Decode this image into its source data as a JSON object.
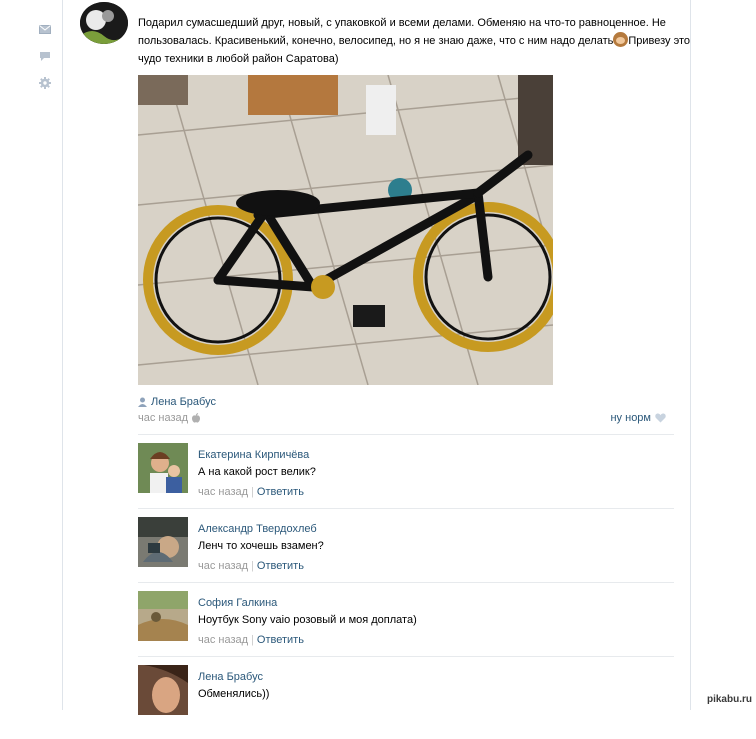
{
  "sidebar": {
    "icons": [
      "envelope-icon",
      "speech-bubble-icon",
      "gear-icon"
    ]
  },
  "post": {
    "text_part1": "Подарил сумасшедший друг, новый, с упаковкой и всеми делами. Обменяю на что-то равноценное. Не пользовалась. Красивенький, конечно, велосипед, но я не знаю даже, что с ним надо делать",
    "text_part2": "Привезу это чудо техники в любой район Саратова)",
    "emoji": "see-no-evil-monkey",
    "photo_subject": "black BMX bike with gold wheels",
    "author": "Лена Брабус",
    "time": "час назад",
    "platform_icon": "apple-icon",
    "like_label": "ну норм",
    "like_icon": "heart-icon"
  },
  "comments": [
    {
      "name": "Екатерина Кирпичёва",
      "text": "А на какой рост велик?",
      "time": "час назад",
      "separator": "|",
      "reply_label": "Ответить"
    },
    {
      "name": "Александр Твердохлеб",
      "text": "Ленч то хочешь взамен?",
      "time": "час назад",
      "separator": "|",
      "reply_label": "Ответить"
    },
    {
      "name": "София Галкина",
      "text": "Ноутбук Sony vaio розовый и моя доплата)",
      "time": "час назад",
      "separator": "|",
      "reply_label": "Ответить"
    },
    {
      "name": "Лена Брабус",
      "text": "Обменялись))"
    }
  ],
  "watermark": "pikabu.ru",
  "colors": {
    "link": "#2b587a",
    "muted": "#999999",
    "divider": "#e7eaed"
  }
}
